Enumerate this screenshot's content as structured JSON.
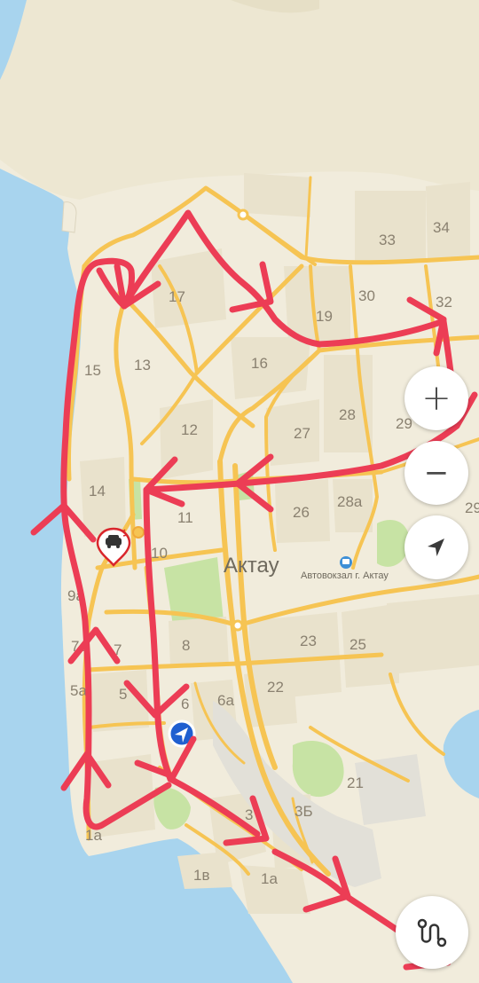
{
  "map": {
    "city_label": "Актау",
    "poi_bus_station": "Автовокзал г. Актау",
    "districts": [
      "33",
      "34",
      "30",
      "32",
      "17",
      "19",
      "15",
      "13",
      "16",
      "12",
      "28",
      "29",
      "27",
      "14",
      "11",
      "26",
      "28а",
      "10",
      "9а",
      "8",
      "23",
      "25",
      "7а",
      "7",
      "5а",
      "5",
      "6",
      "6а",
      "22",
      "21",
      "3",
      "3Б",
      "1в",
      "1а",
      "29",
      "1а"
    ]
  },
  "controls": {
    "zoom_in_symbol": "+",
    "zoom_out_symbol": "−"
  },
  "colors": {
    "water": "#a8d4ee",
    "land": "#f1ecdc",
    "road": "#f6c453",
    "park": "#c7e3a4",
    "route_drawing": "#ec3d55",
    "location_marker": "#1f5fd0"
  }
}
